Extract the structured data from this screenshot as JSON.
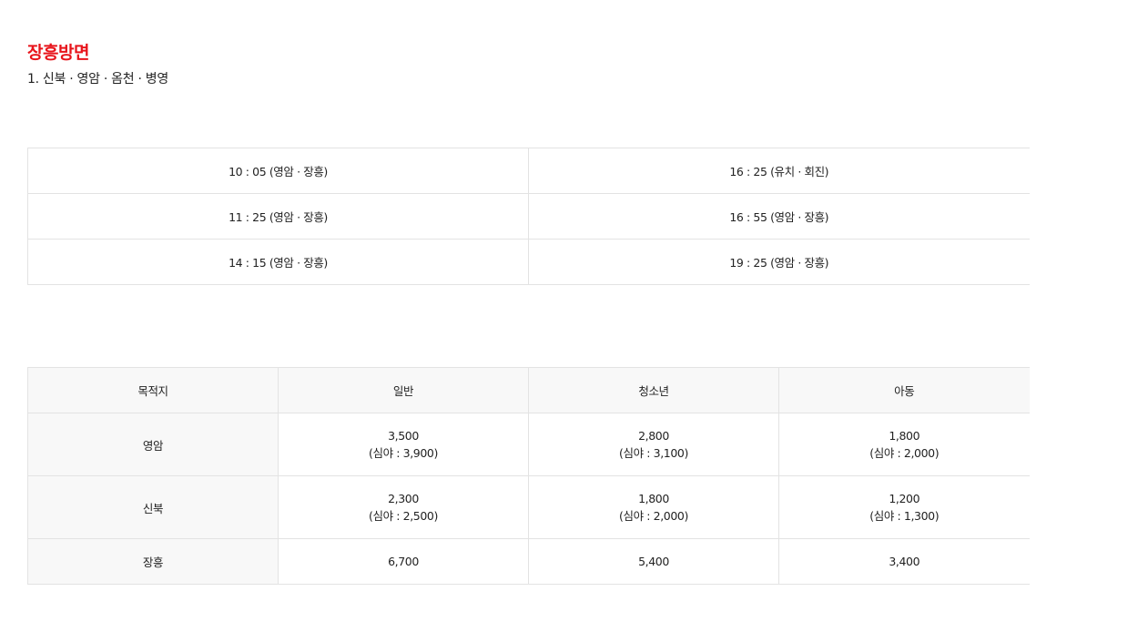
{
  "page": {
    "title": "장흥방면",
    "route": "1. 신북 · 영암 · 옴천 · 병영"
  },
  "schedule": {
    "rows": [
      {
        "left": "10 : 05 (영암 · 장흥)",
        "right": "16 : 25 (유치 · 회진)"
      },
      {
        "left": "11 : 25 (영암 · 장흥)",
        "right": "16 : 55 (영암 · 장흥)"
      },
      {
        "left": "14 : 15 (영암 · 장흥)",
        "right": "19 : 25 (영암 · 장흥)"
      }
    ]
  },
  "fare": {
    "headers": [
      "목적지",
      "일반",
      "청소년",
      "아동"
    ],
    "rows": [
      {
        "destination": "영암",
        "general": "3,500",
        "general_night": "(심야 : 3,900)",
        "youth": "2,800",
        "youth_night": "(심야 : 3,100)",
        "child": "1,800",
        "child_night": "(심야 : 2,000)"
      },
      {
        "destination": "신북",
        "general": "2,300",
        "general_night": "(심야 : 2,500)",
        "youth": "1,800",
        "youth_night": "(심야 : 2,000)",
        "child": "1,200",
        "child_night": "(심야 : 1,300)"
      },
      {
        "destination": "장흥",
        "general": "6,700",
        "youth": "5,400",
        "child": "3,400"
      }
    ]
  },
  "colors": {
    "title": "#e8141b",
    "border": "#e3e3e3",
    "header_bg": "#f8f8f8"
  }
}
